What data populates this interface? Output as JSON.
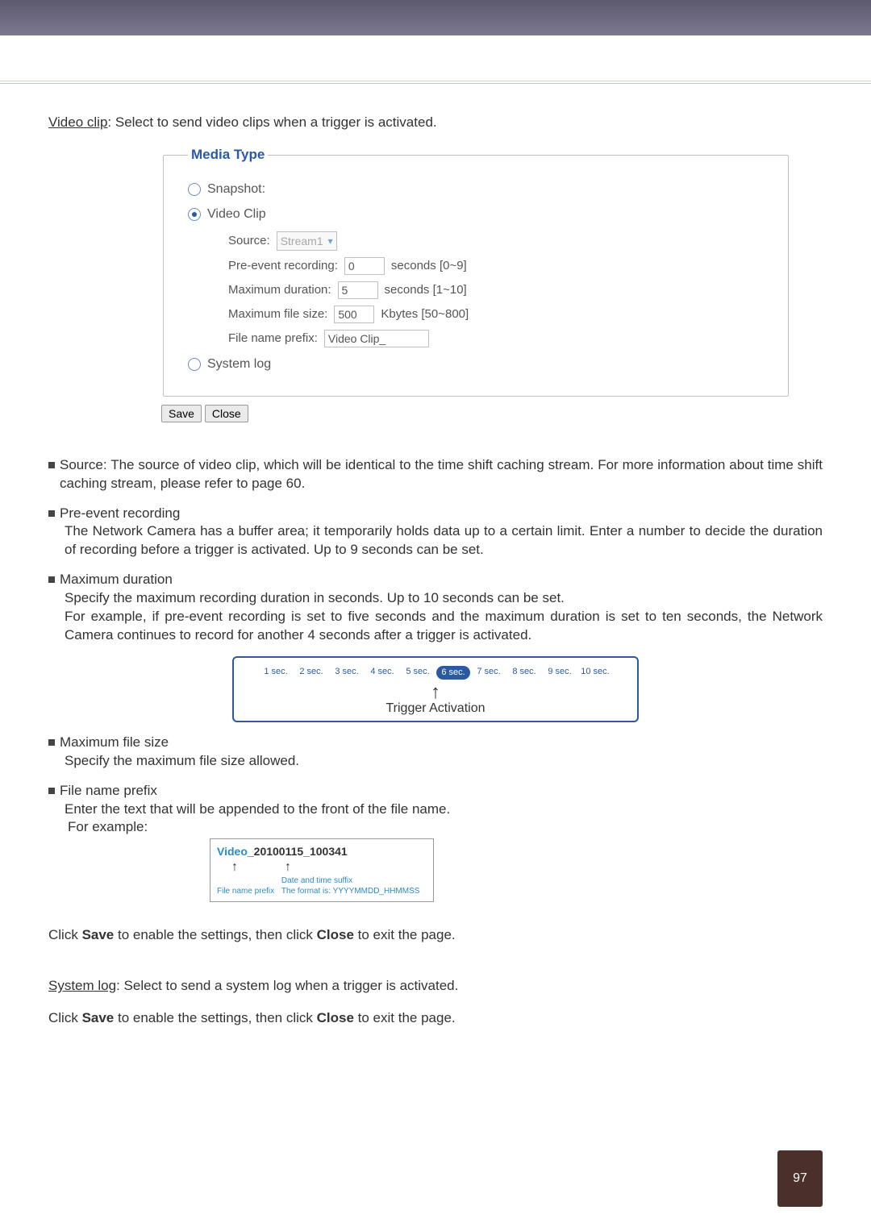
{
  "intro": {
    "underlined": "Video clip",
    "rest": ": Select to send video clips when a trigger is activated."
  },
  "fieldset": {
    "legend": "Media Type",
    "snapshot_label": "Snapshot:",
    "videoclip_label": "Video Clip",
    "systemlog_label": "System log"
  },
  "fields": {
    "source_label": "Source:",
    "source_value": "Stream1",
    "preevent_label": "Pre-event recording:",
    "preevent_value": "0",
    "preevent_suffix": "seconds [0~9]",
    "maxdur_label": "Maximum duration:",
    "maxdur_value": "5",
    "maxdur_suffix": "seconds [1~10]",
    "maxsize_label": "Maximum file size:",
    "maxsize_value": "500",
    "maxsize_suffix": "Kbytes [50~800]",
    "prefix_label": "File name prefix:",
    "prefix_value": "Video Clip_"
  },
  "buttons": {
    "save": "Save",
    "close": "Close"
  },
  "paragraph_source": "Source: The source of video clip, which will be identical to the time shift caching stream. For more information about time shift caching stream, please refer to page 60.",
  "preevent_title": "Pre-event recording",
  "preevent_body": "The Network Camera has a buffer area; it temporarily holds data up to a certain limit. Enter a number to decide the duration of recording before a trigger is activated. Up to 9 seconds can be set.",
  "maxdur_title": "Maximum duration",
  "maxdur_body1": "Specify the maximum recording duration in seconds. Up to 10 seconds can be set.",
  "maxdur_body2": "For example, if pre-event recording is set to five seconds and the maximum duration is set to ten seconds, the Network Camera continues to record for another 4 seconds after a trigger is activated.",
  "secs": [
    "1 sec.",
    "2 sec.",
    "3 sec.",
    "4 sec.",
    "5 sec.",
    "6 sec.",
    "7 sec.",
    "8 sec.",
    "9 sec.",
    "10 sec."
  ],
  "trigger_label": "Trigger Activation",
  "maxsize_title": "Maximum file size",
  "maxsize_body": "Specify the maximum file size allowed.",
  "prefix_title": "File name prefix",
  "prefix_body1": "Enter the text that will be appended to the front of the file name.",
  "prefix_body2": "For example:",
  "fname": {
    "prefix": "Video",
    "dt": "_20100115_100341",
    "cap1": "File name prefix",
    "cap2a": "Date and time suffix",
    "cap2b": "The format is: YYYYMMDD_HHMMSS"
  },
  "click_save1a": "Click ",
  "click_save1b": "Save",
  "click_save1c": " to enable the settings, then click ",
  "click_save1d": "Close",
  "click_save1e": " to exit the page.",
  "syslog_ul": "System log",
  "syslog_rest": ": Select to send a system log when a trigger is activated.",
  "pagenum": "97"
}
